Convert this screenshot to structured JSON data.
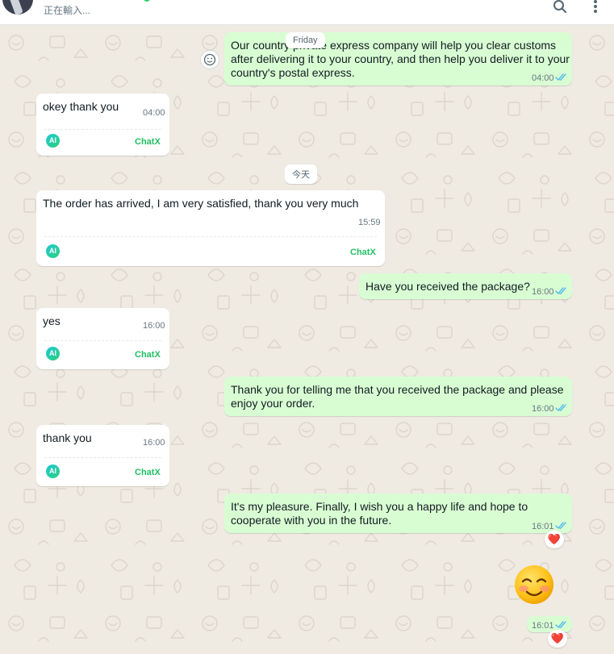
{
  "header": {
    "status": "正在輸入..."
  },
  "icons": {
    "search": "search-icon",
    "menu": "menu-icon",
    "emoji": "smiley-icon",
    "ai": "ai-icon",
    "read": "double-check-icon"
  },
  "colors": {
    "outgoing_bubble": "#d9fdd3",
    "incoming_bubble": "#ffffff",
    "read_ticks": "#53bdeb",
    "chatx_brand": "#21c063",
    "background": "#efeae2"
  },
  "dates": {
    "friday": "Friday",
    "today": "今天"
  },
  "messages": {
    "m1": {
      "text": "Our country private express company will help you clear customs after delivering it to your country, and then help you deliver it to your country's postal express.",
      "time": "04:00"
    },
    "m2": {
      "text": "okey thank you",
      "time": "04:00",
      "tag": "ChatX"
    },
    "m3": {
      "text": "The order has arrived, I am very satisfied, thank you very much",
      "time": "15:59",
      "tag": "ChatX"
    },
    "m4": {
      "text": "Have you received the package?",
      "time": "16:00"
    },
    "m5": {
      "text": "yes",
      "time": "16:00",
      "tag": "ChatX"
    },
    "m6": {
      "text": "Thank you for telling me that you received the package and please enjoy your order.",
      "time": "16:00"
    },
    "m7": {
      "text": "thank you",
      "time": "16:00",
      "tag": "ChatX"
    },
    "m8": {
      "text": "It's my pleasure. Finally, I wish you a happy life and hope to cooperate with you in the future.",
      "time": "16:01",
      "reaction": "❤️"
    },
    "m9": {
      "emoji": "☺️",
      "time": "16:01",
      "reaction": "❤️"
    }
  }
}
